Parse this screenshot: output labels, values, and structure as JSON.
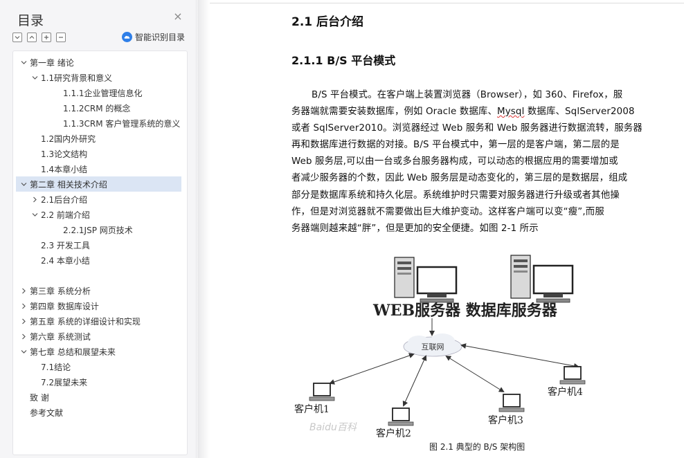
{
  "outline": {
    "title": "目录",
    "close_glyph": "×",
    "smart_toc_label": "智能识别目录",
    "items": [
      {
        "label": "第一章  绪论",
        "level": 0,
        "expanded": true
      },
      {
        "label": "1.1研究背景和意义",
        "level": 1,
        "expanded": true
      },
      {
        "label": "1.1.1企业管理信息化",
        "level": 2
      },
      {
        "label": "1.1.2CRM 的概念",
        "level": 2
      },
      {
        "label": "1.1.3CRM 客户管理系统的意义",
        "level": 2
      },
      {
        "label": "1.2国内外研究",
        "level": 1
      },
      {
        "label": "1.3论文结构",
        "level": 1
      },
      {
        "label": "1.4本章小结",
        "level": 1
      },
      {
        "label": "第二章  相关技术介绍",
        "level": 0,
        "expanded": true,
        "active": true
      },
      {
        "label": "2.1后台介绍",
        "level": 1,
        "expanded": false
      },
      {
        "label": "2.2 前端介绍",
        "level": 1,
        "expanded": true
      },
      {
        "label": "2.2.1JSP 网页技术",
        "level": 2
      },
      {
        "label": "2.3 开发工具",
        "level": 1
      },
      {
        "label": "2.4 本章小结",
        "level": 1
      },
      {
        "label": "第三章  系统分析",
        "level": 0,
        "expanded": false,
        "gap": true
      },
      {
        "label": "第四章  数据库设计",
        "level": 0,
        "expanded": false
      },
      {
        "label": "第五章  系统的详细设计和实现",
        "level": 0,
        "expanded": false
      },
      {
        "label": "第六章  系统测试",
        "level": 0,
        "expanded": false
      },
      {
        "label": "第七章  总结和展望未来",
        "level": 0,
        "expanded": true
      },
      {
        "label": "7.1结论",
        "level": 1
      },
      {
        "label": "7.2展望未来",
        "level": 1
      },
      {
        "label": "致   谢",
        "level": 0
      },
      {
        "label": "参考文献",
        "level": 0
      }
    ]
  },
  "document": {
    "section_heading": "2.1 后台介绍",
    "subsection_heading": "2.1.1 B/S 平台模式",
    "paragraph_lines": [
      "B/S 平台模式。在客户端上装置浏览器（Browser），如 360、Firefox，服",
      "务器端就需要安装数据库，例如 Oracle 数据库、",
      "或者 SqlServer2010。浏览器经过 Web 服务和 Web 服务器进行数据流转，服务器",
      "再和数据库进行数据的对接。B/S 平台模式中，第一层的是客户端，第二层的是",
      "Web 服务层,可以由一台或多台服务器构成，可以动态的根据应用的需要增加或",
      "者减少服务器的个数，因此 Web 服务层是动态变化的，第三层的是数据层，组成",
      "部分是数据库系统和持久化层。系统维护时只需要对服务器进行升级或者其他操",
      "作，但是对浏览器就不需要做出巨大维护变动。这样客户端可以变“瘦”,而服",
      "务器端则越来越“胖”，但是更加的安全便捷。如图 2-1 所示"
    ],
    "line2_mysql": "Mysql",
    "line2_tail": " 数据库、SqlServer2008",
    "figure": {
      "server_label": "WEB服务器 数据库服务器",
      "internet_label": "互联网",
      "client_labels": [
        "客户机1",
        "客户机2",
        "客户机3",
        "客户机4"
      ],
      "watermark": "Baidu百科"
    },
    "caption": "图 2.1 典型的 B/S 架构图"
  },
  "colors": {
    "pane_bg": "#f5f5f7",
    "active_row": "#dbe5f4",
    "accent": "#2f7fe8"
  },
  "icons": {
    "collapse_all": "square-chevron-down-icon",
    "expand_up": "square-chevron-up-icon",
    "add": "square-plus-icon",
    "remove": "square-minus-icon",
    "smart": "cloud-icon",
    "close": "close-icon"
  }
}
